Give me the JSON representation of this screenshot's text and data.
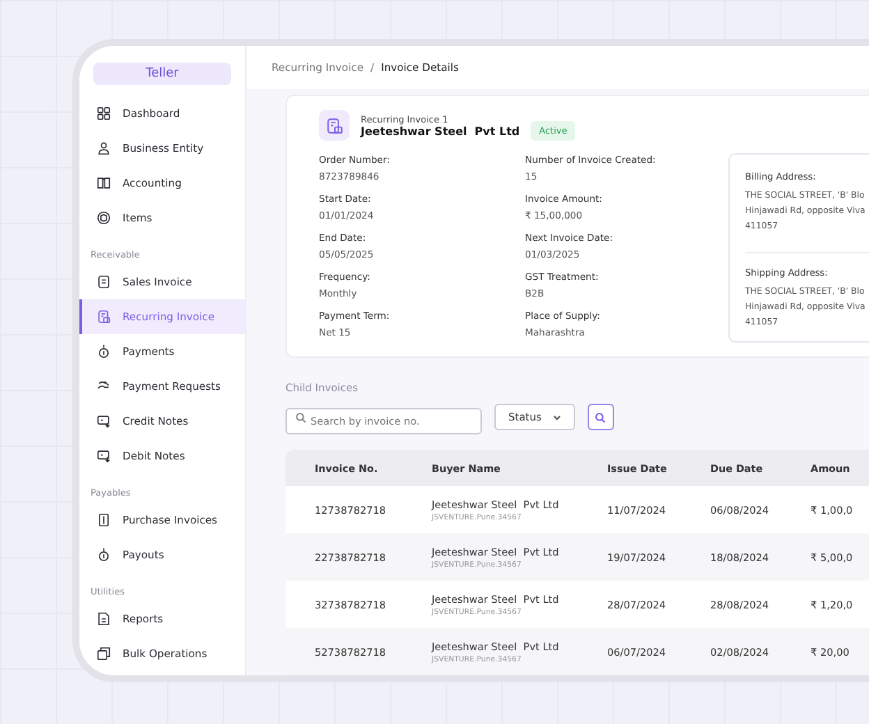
{
  "sidebar": {
    "brand": "Teller",
    "sections": [
      {
        "items": [
          {
            "label": "Dashboard",
            "selected": false
          },
          {
            "label": "Business Entity",
            "selected": false
          },
          {
            "label": "Accounting",
            "selected": false
          },
          {
            "label": "Items",
            "selected": false
          }
        ]
      },
      {
        "heading": "Receivable",
        "items": [
          {
            "label": "Sales Invoice",
            "selected": false
          },
          {
            "label": "Recurring Invoice",
            "selected": true
          },
          {
            "label": "Payments",
            "selected": false
          },
          {
            "label": "Payment Requests",
            "selected": false
          },
          {
            "label": "Credit Notes",
            "selected": false
          },
          {
            "label": "Debit Notes",
            "selected": false
          }
        ]
      },
      {
        "heading": "Payables",
        "items": [
          {
            "label": "Purchase Invoices",
            "selected": false
          },
          {
            "label": "Payouts",
            "selected": false
          }
        ]
      },
      {
        "heading": "Utilities",
        "items": [
          {
            "label": "Reports",
            "selected": false
          },
          {
            "label": "Bulk Operations",
            "selected": false
          }
        ]
      }
    ]
  },
  "breadcrumb": [
    "Recurring Invoice",
    "/",
    "Invoice Details"
  ],
  "invoice": {
    "subtitle": "Recurring Invoice 1",
    "name": "Jeeteshwar Steel  Pvt Ltd",
    "status": "Active",
    "left_fields": [
      {
        "label": "Order Number:",
        "value": "8723789846"
      },
      {
        "label": "Start Date:",
        "value": "01/01/2024"
      },
      {
        "label": "End Date:",
        "value": "05/05/2025"
      },
      {
        "label": "Frequency:",
        "value": "Monthly"
      },
      {
        "label": "Payment Term:",
        "value": "Net 15"
      }
    ],
    "right_fields": [
      {
        "label": "Number of Invoice Created:",
        "value": "15"
      },
      {
        "label": "Invoice Amount:",
        "value": "₹ 15,00,000"
      },
      {
        "label": "Next Invoice Date:",
        "value": "01/03/2025"
      },
      {
        "label": "GST Treatment:",
        "value": "B2B"
      },
      {
        "label": "Place of Supply:",
        "value": "Maharashtra"
      }
    ],
    "addresses": [
      {
        "label": "Billing Address:",
        "lines": [
          "THE SOCIAL STREET, 'B' Blo",
          "Hinjawadi Rd, opposite Viva",
          "411057"
        ]
      },
      {
        "label": "Shipping Address:",
        "lines": [
          "THE SOCIAL STREET, 'B' Blo",
          "Hinjawadi Rd, opposite Viva",
          "411057"
        ]
      }
    ]
  },
  "child_invoices": {
    "title": "Child Invoices",
    "search": {
      "placeholder": "Search by invoice no."
    },
    "status_filter": "Status",
    "columns": [
      "Invoice No.",
      "Buyer Name",
      "Issue Date",
      "Due Date",
      "Amoun"
    ],
    "rows": [
      {
        "invoice_no": "12738782718",
        "buyer": "Jeeteshwar Steel  Pvt Ltd",
        "buyer_id": "JSVENTURE.Pune.34567",
        "issue_date": "11/07/2024",
        "due_date": "06/08/2024",
        "amount": "₹ 1,00,0"
      },
      {
        "invoice_no": "22738782718",
        "buyer": "Jeeteshwar Steel  Pvt Ltd",
        "buyer_id": "JSVENTURE.Pune.34567",
        "issue_date": "19/07/2024",
        "due_date": "18/08/2024",
        "amount": "₹ 5,00,0"
      },
      {
        "invoice_no": "32738782718",
        "buyer": "Jeeteshwar Steel  Pvt Ltd",
        "buyer_id": "JSVENTURE.Pune.34567",
        "issue_date": "28/07/2024",
        "due_date": "28/08/2024",
        "amount": "₹ 1,20,0"
      },
      {
        "invoice_no": "52738782718",
        "buyer": "Jeeteshwar Steel  Pvt Ltd",
        "buyer_id": "JSVENTURE.Pune.34567",
        "issue_date": "06/07/2024",
        "due_date": "02/08/2024",
        "amount": "₹ 20,00"
      }
    ]
  }
}
